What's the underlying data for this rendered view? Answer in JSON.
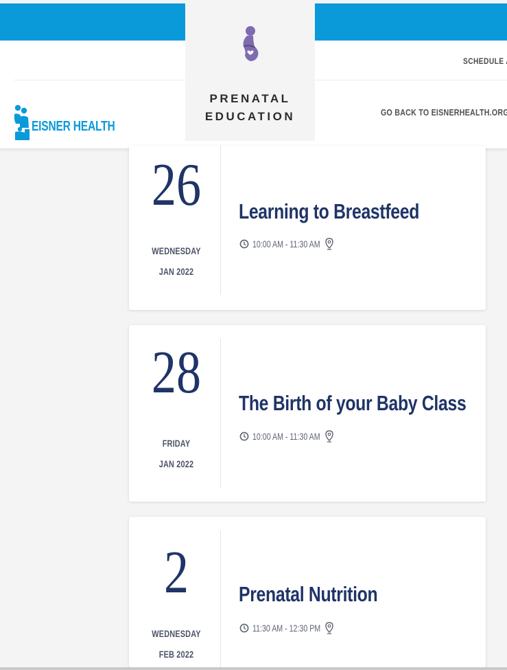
{
  "header": {
    "schedule_link": "SCHEDULE AN",
    "go_back_link": "GO BACK TO EISNERHEALTH.ORG",
    "logo_text": "EISNER HEALTH",
    "badge_title_line1": "PRENATAL",
    "badge_title_line2": "EDUCATION",
    "badge_icon": "pregnant-woman-icon"
  },
  "colors": {
    "brand_blue": "#0a9ad9",
    "navy": "#1f3467",
    "badge_purple": "#7f6bb0"
  },
  "events": [
    {
      "day": "26",
      "weekday": "WEDNESDAY",
      "month_year": "JAN 2022",
      "title": "Learning to Breastfeed",
      "time": "10:00 AM - 11:30 AM",
      "icons": [
        "clock-icon",
        "location-pin-icon"
      ]
    },
    {
      "day": "28",
      "weekday": "FRIDAY",
      "month_year": "JAN 2022",
      "title": "The Birth of your Baby Class",
      "time": "10:00 AM - 11:30 AM",
      "icons": [
        "clock-icon",
        "location-pin-icon"
      ]
    },
    {
      "day": "2",
      "weekday": "WEDNESDAY",
      "month_year": "FEB 2022",
      "title": "Prenatal Nutrition",
      "time": "11:30 AM - 12:30 PM",
      "icons": [
        "clock-icon",
        "location-pin-icon"
      ]
    }
  ]
}
